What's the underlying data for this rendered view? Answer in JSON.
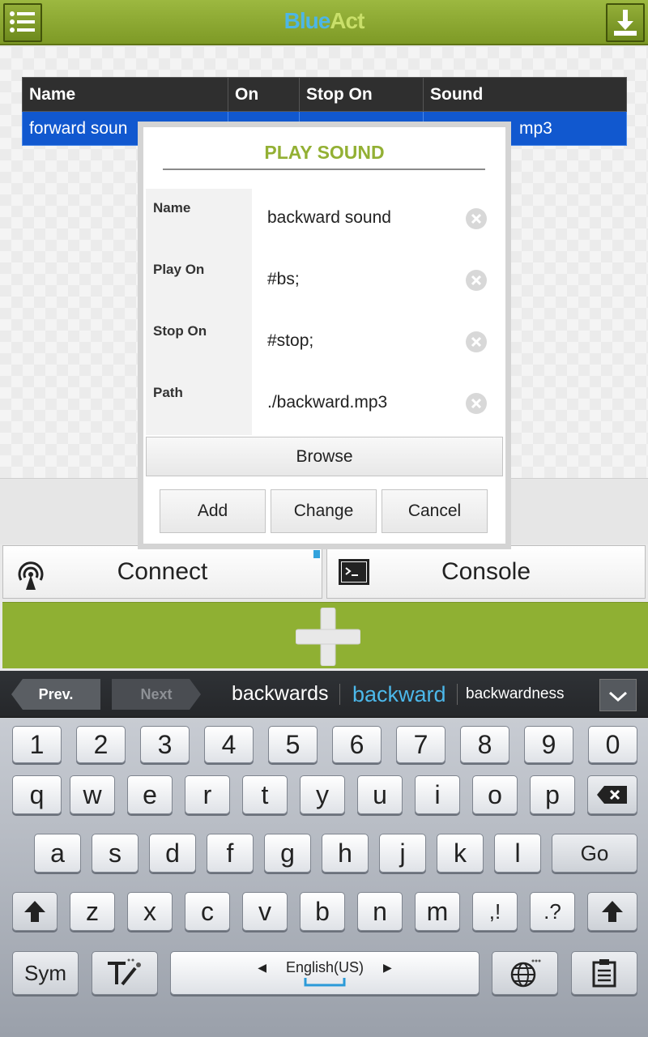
{
  "header": {
    "brand_part1": "Blue",
    "brand_part2": "Act"
  },
  "table": {
    "columns": [
      "Name",
      "On",
      "Stop On",
      "Sound"
    ],
    "row": {
      "name": "forward soun",
      "on": "",
      "stop_on": "",
      "sound": "mp3"
    }
  },
  "dialog": {
    "title": "PLAY SOUND",
    "fields": [
      {
        "label": "Name",
        "value": "backward sound"
      },
      {
        "label": "Play On",
        "value": "#bs;"
      },
      {
        "label": "Stop On",
        "value": "#stop;"
      },
      {
        "label": "Path",
        "value": "./backward.mp3"
      }
    ],
    "browse_label": "Browse",
    "add_label": "Add",
    "change_label": "Change",
    "cancel_label": "Cancel"
  },
  "buttons": {
    "connect_label": "Connect",
    "console_label": "Console"
  },
  "suggestions": {
    "prev_label": "Prev.",
    "next_label": "Next",
    "words": [
      "backwards",
      "backward",
      "backwardness"
    ]
  },
  "keyboard": {
    "row_numbers": [
      "1",
      "2",
      "3",
      "4",
      "5",
      "6",
      "7",
      "8",
      "9",
      "0"
    ],
    "row_q": [
      "q",
      "w",
      "e",
      "r",
      "t",
      "y",
      "u",
      "i",
      "o",
      "p"
    ],
    "row_a": [
      "a",
      "s",
      "d",
      "f",
      "g",
      "h",
      "j",
      "k",
      "l"
    ],
    "row_z": [
      "z",
      "x",
      "c",
      "v",
      "b",
      "n",
      "m"
    ],
    "comma_label": ",!",
    "period_label": ".?",
    "go_label": "Go",
    "sym_label": "Sym",
    "language_label": "English(US)"
  },
  "colors": {
    "accent_green": "#8fb033",
    "selection_blue": "#1158cf",
    "brand_blue": "#4db6e6"
  }
}
